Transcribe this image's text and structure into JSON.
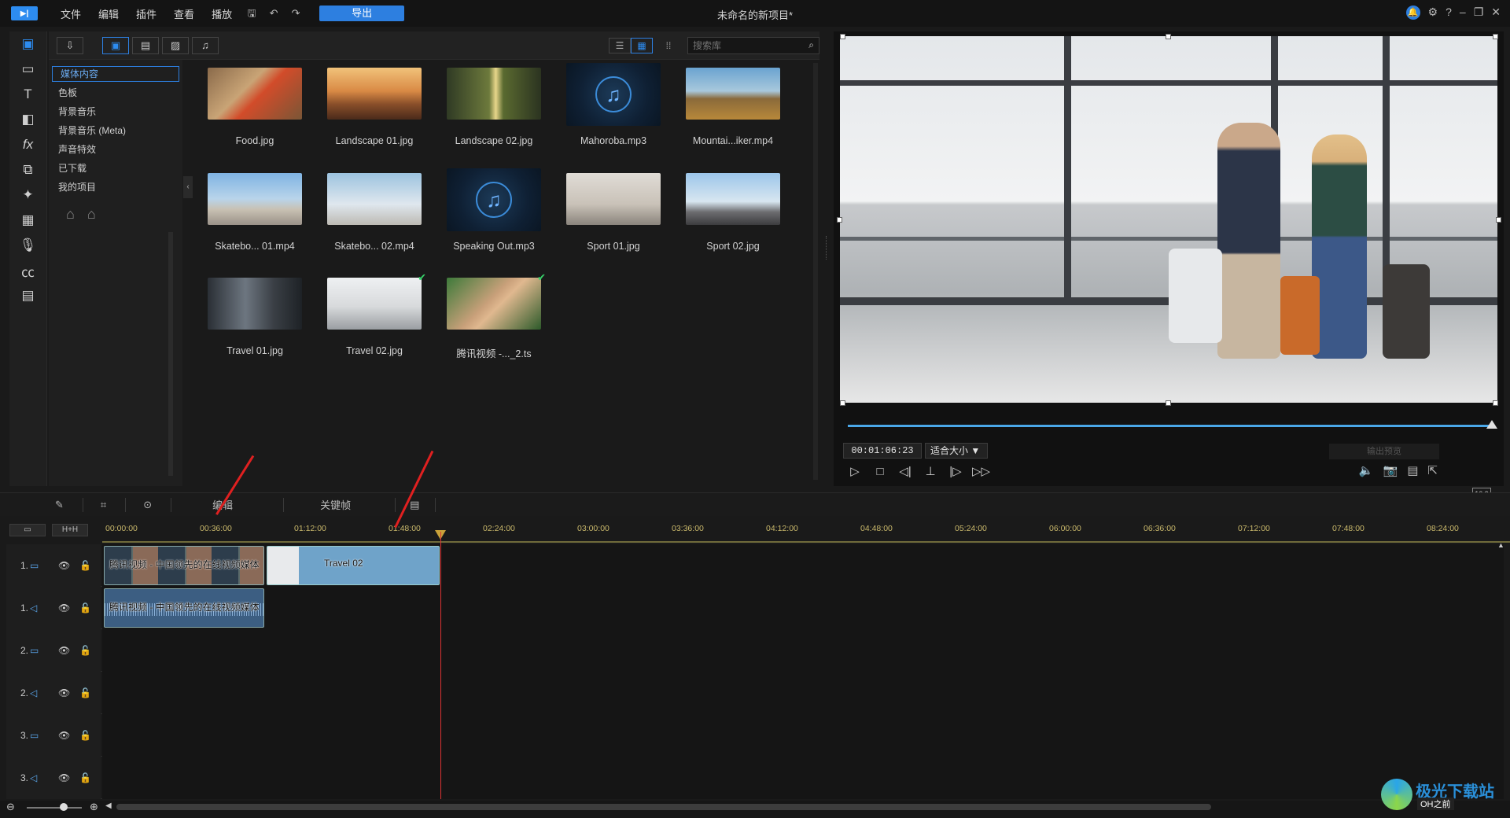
{
  "app": {
    "title": "未命名的新项目*",
    "menus": [
      "文件",
      "编辑",
      "插件",
      "查看",
      "播放"
    ],
    "export_label": "导出"
  },
  "media_toolbar": {
    "search_placeholder": "搜索库"
  },
  "categories": [
    "媒体内容",
    "色板",
    "背景音乐",
    "背景音乐 (Meta)",
    "声音特效",
    "已下载",
    "我的项目"
  ],
  "library": [
    {
      "name": "Food.jpg",
      "kind": "photo"
    },
    {
      "name": "Landscape 01.jpg",
      "kind": "photo"
    },
    {
      "name": "Landscape 02.jpg",
      "kind": "photo"
    },
    {
      "name": "Mahoroba.mp3",
      "kind": "music"
    },
    {
      "name": "Mountai...iker.mp4",
      "kind": "video"
    },
    {
      "name": "Skatebo... 01.mp4",
      "kind": "video"
    },
    {
      "name": "Skatebo... 02.mp4",
      "kind": "video"
    },
    {
      "name": "Speaking Out.mp3",
      "kind": "music"
    },
    {
      "name": "Sport 01.jpg",
      "kind": "photo"
    },
    {
      "name": "Sport 02.jpg",
      "kind": "photo"
    },
    {
      "name": "Travel 01.jpg",
      "kind": "photo"
    },
    {
      "name": "Travel 02.jpg",
      "kind": "photo",
      "used": true
    },
    {
      "name": "腾讯视频 -..._2.ts",
      "kind": "video",
      "used": true
    }
  ],
  "preview": {
    "timecode": "00:01:06:23",
    "fit": "适合大小 ▼",
    "output_preview": "输出预览",
    "aspect": "16:9"
  },
  "timeline_toolbar": {
    "edit": "编辑",
    "keyframe": "关键帧"
  },
  "ruler_ticks": [
    "00:00:00",
    "00:36:00",
    "01:12:00",
    "01:48:00",
    "02:24:00",
    "03:00:00",
    "03:36:00",
    "04:12:00",
    "04:48:00",
    "05:24:00",
    "06:00:00",
    "06:36:00",
    "07:12:00",
    "07:48:00",
    "08:24:00"
  ],
  "tracks": [
    {
      "num": "1.",
      "type": "video"
    },
    {
      "num": "1.",
      "type": "audio"
    },
    {
      "num": "2.",
      "type": "video"
    },
    {
      "num": "2.",
      "type": "audio"
    },
    {
      "num": "3.",
      "type": "video"
    },
    {
      "num": "3.",
      "type": "audio"
    }
  ],
  "clips": {
    "video1_label": "腾讯视频 - 中国领先的在线视频媒体",
    "video2_label": "Travel 02",
    "audio1_label": "腾讯视频 - 中国领先的在线视频媒体"
  },
  "watermark": {
    "text": "极光下载站",
    "sub": "OH之前"
  },
  "colors": {
    "accent": "#2d7fe0",
    "playhead": "#dd3333",
    "ruler_label": "#c9b86b",
    "clip_selected": "#6fa3c9"
  }
}
